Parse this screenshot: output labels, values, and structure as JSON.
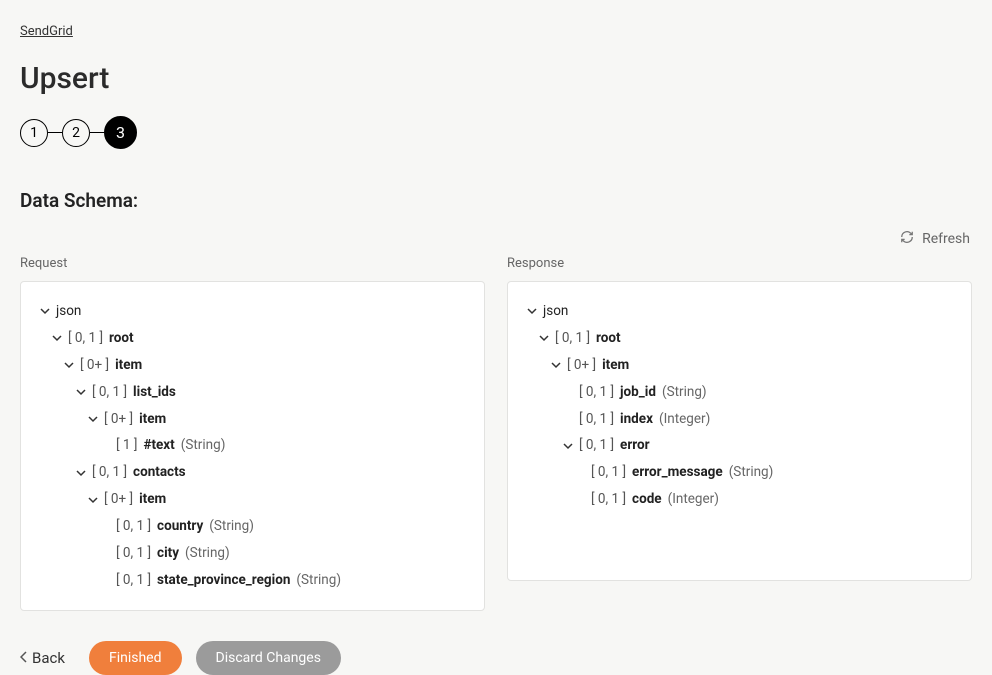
{
  "breadcrumb": "SendGrid",
  "title": "Upsert",
  "steps": [
    "1",
    "2",
    "3"
  ],
  "section_title": "Data Schema:",
  "refresh_label": "Refresh",
  "request_label": "Request",
  "response_label": "Response",
  "request_tree": {
    "root_name": "json",
    "n0_card": "[ 0, 1 ]",
    "n0_name": "root",
    "n1_card": "[ 0+ ]",
    "n1_name": "item",
    "n2_card": "[ 0, 1 ]",
    "n2_name": "list_ids",
    "n3_card": "[ 0+ ]",
    "n3_name": "item",
    "n4_card": "[ 1 ]",
    "n4_name": "#text",
    "n4_type": "(String)",
    "n5_card": "[ 0, 1 ]",
    "n5_name": "contacts",
    "n6_card": "[ 0+ ]",
    "n6_name": "item",
    "n7_card": "[ 0, 1 ]",
    "n7_name": "country",
    "n7_type": "(String)",
    "n8_card": "[ 0, 1 ]",
    "n8_name": "city",
    "n8_type": "(String)",
    "n9_card": "[ 0, 1 ]",
    "n9_name": "state_province_region",
    "n9_type": "(String)"
  },
  "response_tree": {
    "root_name": "json",
    "n0_card": "[ 0, 1 ]",
    "n0_name": "root",
    "n1_card": "[ 0+ ]",
    "n1_name": "item",
    "n2_card": "[ 0, 1 ]",
    "n2_name": "job_id",
    "n2_type": "(String)",
    "n3_card": "[ 0, 1 ]",
    "n3_name": "index",
    "n3_type": "(Integer)",
    "n4_card": "[ 0, 1 ]",
    "n4_name": "error",
    "n5_card": "[ 0, 1 ]",
    "n5_name": "error_message",
    "n5_type": "(String)",
    "n6_card": "[ 0, 1 ]",
    "n6_name": "code",
    "n6_type": "(Integer)"
  },
  "footer": {
    "back": "Back",
    "finished": "Finished",
    "discard": "Discard Changes"
  }
}
